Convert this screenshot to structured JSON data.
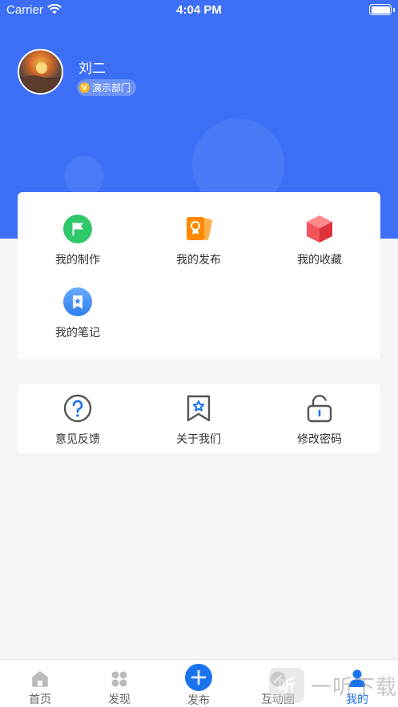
{
  "status_bar": {
    "carrier": "Carrier",
    "time": "4:04 PM"
  },
  "profile": {
    "name": "刘二",
    "badge_letter": "V",
    "department": "演示部门"
  },
  "features": [
    {
      "label": "我的制作",
      "icon": "flag-icon",
      "color": "#2fc86a"
    },
    {
      "label": "我的发布",
      "icon": "publish-cards-icon",
      "color": "#ff8a00"
    },
    {
      "label": "我的收藏",
      "icon": "cube-icon",
      "color": "#f3545c"
    },
    {
      "label": "我的笔记",
      "icon": "bookmark-note-icon",
      "color": "#3f8cf3"
    }
  ],
  "settings": [
    {
      "label": "意见反馈",
      "icon": "question-circle-icon"
    },
    {
      "label": "关于我们",
      "icon": "star-bookmark-icon"
    },
    {
      "label": "修改密码",
      "icon": "unlock-icon"
    }
  ],
  "tabs": [
    {
      "label": "首页",
      "icon": "home-icon",
      "active": false
    },
    {
      "label": "发现",
      "icon": "discover-icon",
      "active": false
    },
    {
      "label": "发布",
      "icon": "plus-circle-icon",
      "active": false
    },
    {
      "label": "互动圈",
      "icon": "circle-icon",
      "active": false
    },
    {
      "label": "我的",
      "icon": "user-icon",
      "active": true
    }
  ],
  "watermark": {
    "glyph": "听",
    "text": "一听下载"
  },
  "colors": {
    "header_blue": "#3d6ff6",
    "accent": "#1a73ee",
    "background": "#f5f5f5"
  }
}
